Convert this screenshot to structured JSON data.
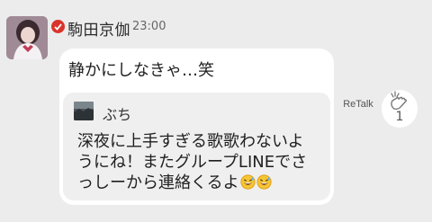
{
  "post": {
    "sender_name": "駒田京伽",
    "timestamp": "23:00",
    "message": "静かにしなきゃ…笑"
  },
  "quoted": {
    "name": "ぶち",
    "text": "深夜に上手すぎる歌歌わないようにね！またグループLINEでさっしーから連絡くるよ",
    "emoji": [
      "grinning-sweat-emoji",
      "grinning-sweat-emoji"
    ]
  },
  "actions": {
    "retalk_label": "ReTalk",
    "clap_count": "1"
  },
  "colors": {
    "background": "#ececec",
    "bubble": "#ffffff",
    "quote_card": "#efefef",
    "verified_badge": "#d9342b"
  }
}
